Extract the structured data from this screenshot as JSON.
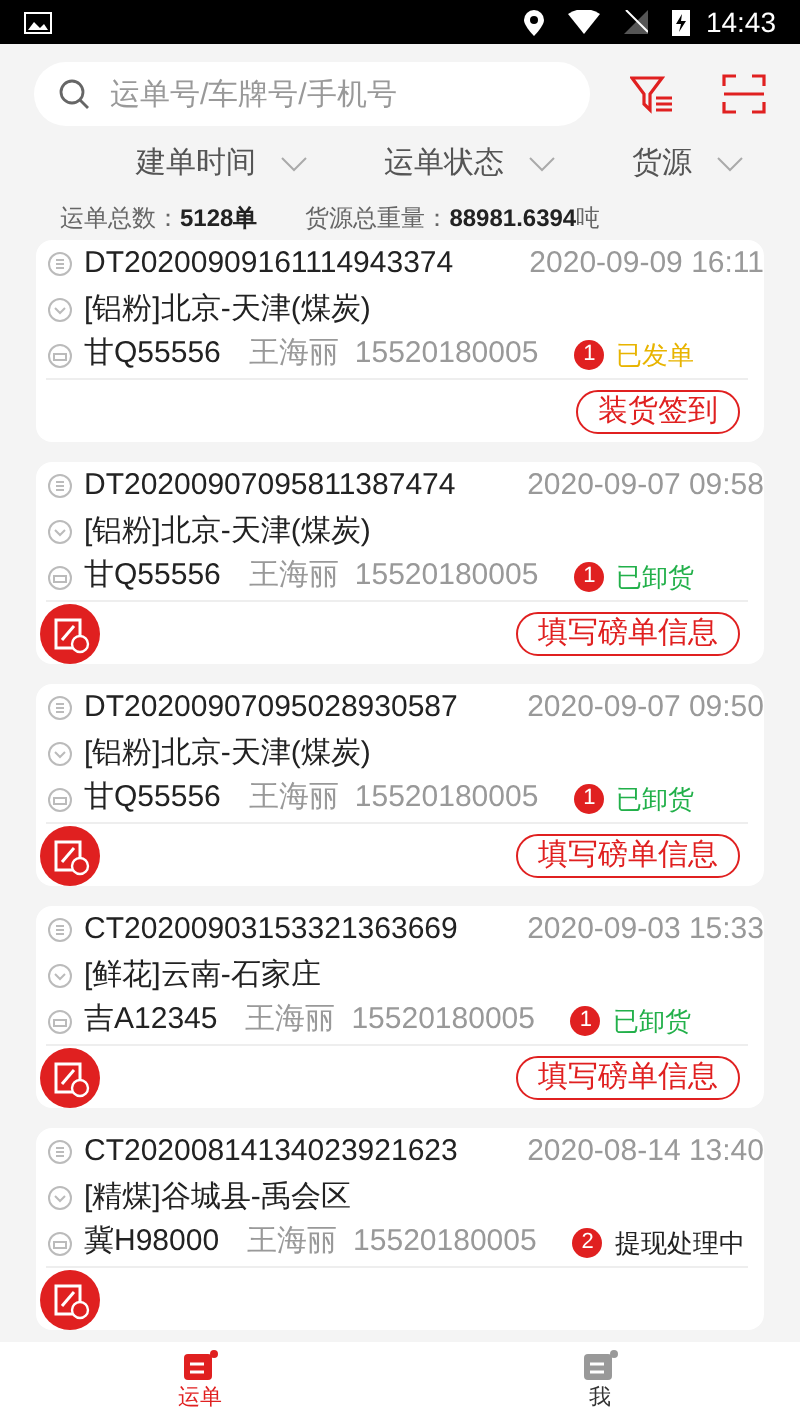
{
  "status_bar": {
    "time": "14:43"
  },
  "search": {
    "placeholder": "运单号/车牌号/手机号"
  },
  "filters": [
    {
      "label": "建单时间"
    },
    {
      "label": "运单状态"
    },
    {
      "label": "货源"
    }
  ],
  "summary": {
    "count_label": "运单总数：",
    "count": "5128单",
    "weight_label": "货源总重量：",
    "weight": "88981.6394",
    "weight_unit": "吨"
  },
  "orders": [
    {
      "id": "DT20200909161114943374",
      "time": "2020-09-09 16:11",
      "route": "[铝粉]北京-天津(煤炭)",
      "plate": "甘Q55556",
      "driver": "王海丽",
      "phone": "15520180005",
      "step": "1",
      "status": "已发单",
      "color": "#e8b400",
      "edit_icon": false,
      "action": "装货签到"
    },
    {
      "id": "DT20200907095811387474",
      "time": "2020-09-07 09:58",
      "route": "[铝粉]北京-天津(煤炭)",
      "plate": "甘Q55556",
      "driver": "王海丽",
      "phone": "15520180005",
      "step": "1",
      "status": "已卸货",
      "color": "#22b04a",
      "edit_icon": true,
      "action": "填写磅单信息"
    },
    {
      "id": "DT20200907095028930587",
      "time": "2020-09-07 09:50",
      "route": "[铝粉]北京-天津(煤炭)",
      "plate": "甘Q55556",
      "driver": "王海丽",
      "phone": "15520180005",
      "step": "1",
      "status": "已卸货",
      "color": "#22b04a",
      "edit_icon": true,
      "action": "填写磅单信息"
    },
    {
      "id": "CT20200903153321363669",
      "time": "2020-09-03 15:33",
      "route": "[鲜花]云南-石家庄",
      "plate": "吉A12345",
      "driver": "王海丽",
      "phone": "15520180005",
      "step": "1",
      "status": "已卸货",
      "color": "#22b04a",
      "edit_icon": true,
      "action": "填写磅单信息"
    },
    {
      "id": "CT20200814134023921623",
      "time": "2020-08-14 13:40",
      "route": "[精煤]谷城县-禹会区",
      "plate": "冀H98000",
      "driver": "王海丽",
      "phone": "15520180005",
      "step": "2",
      "status": "提现处理中",
      "color": "#222222",
      "edit_icon": true
    }
  ],
  "tabs": [
    {
      "label": "运单",
      "selected": true
    },
    {
      "label": "我",
      "selected": false
    }
  ]
}
